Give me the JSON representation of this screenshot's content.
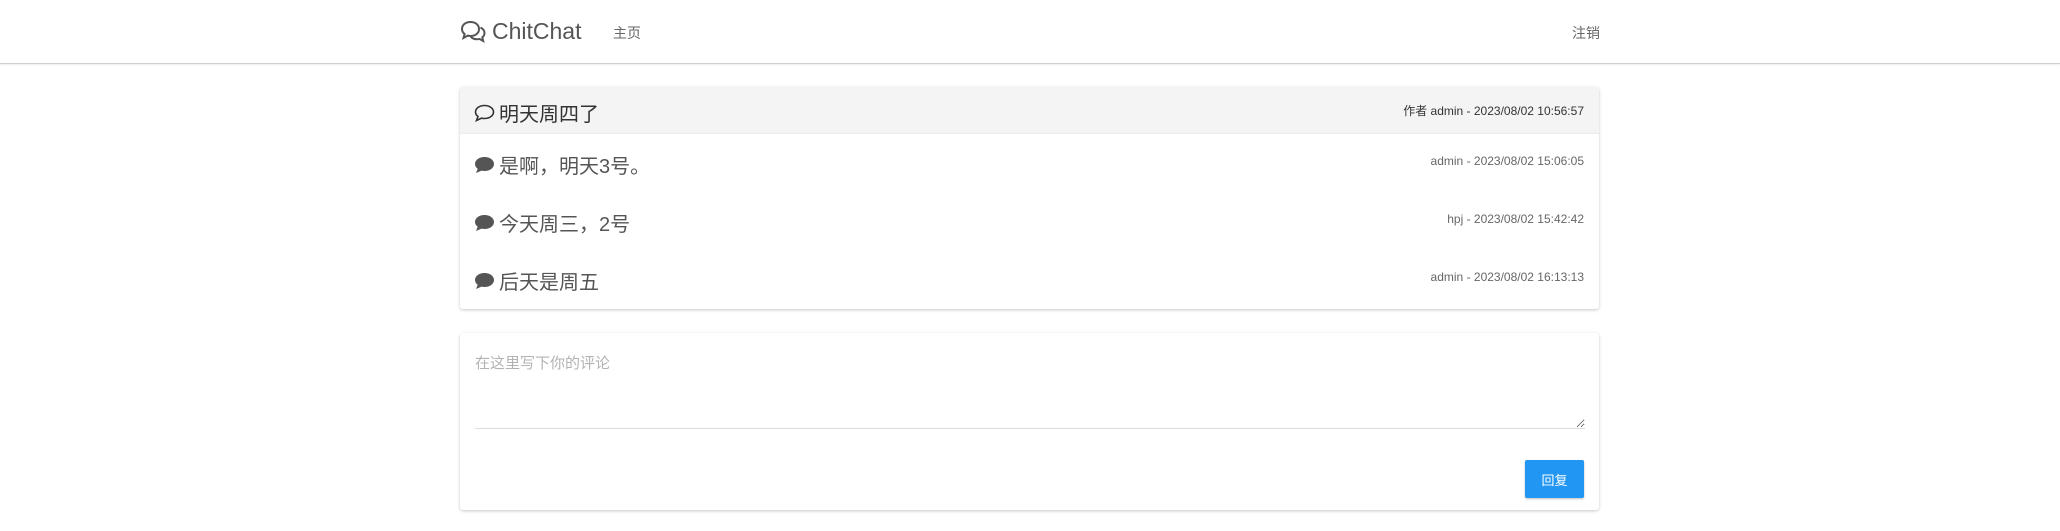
{
  "navbar": {
    "brand": "ChitChat",
    "brand_icon": "comments-icon",
    "home_label": "主页",
    "logout_label": "注销"
  },
  "thread": {
    "title": "明天周四了",
    "title_icon": "comment-outline-icon",
    "meta": "作者 admin - 2023/08/02 10:56:57"
  },
  "replies": [
    {
      "icon": "comment-solid-icon",
      "text": "是啊，明天3号。",
      "meta": "admin - 2023/08/02 15:06:05"
    },
    {
      "icon": "comment-solid-icon",
      "text": "今天周三，2号",
      "meta": "hpj - 2023/08/02 15:42:42"
    },
    {
      "icon": "comment-solid-icon",
      "text": "后天是周五",
      "meta": "admin - 2023/08/02 16:13:13"
    }
  ],
  "comment_form": {
    "value": "",
    "placeholder": "在这里写下你的评论",
    "submit_label": "回复"
  },
  "colors": {
    "accent": "#2196f3",
    "header_bg": "#f4f4f4",
    "text": "#333333"
  }
}
